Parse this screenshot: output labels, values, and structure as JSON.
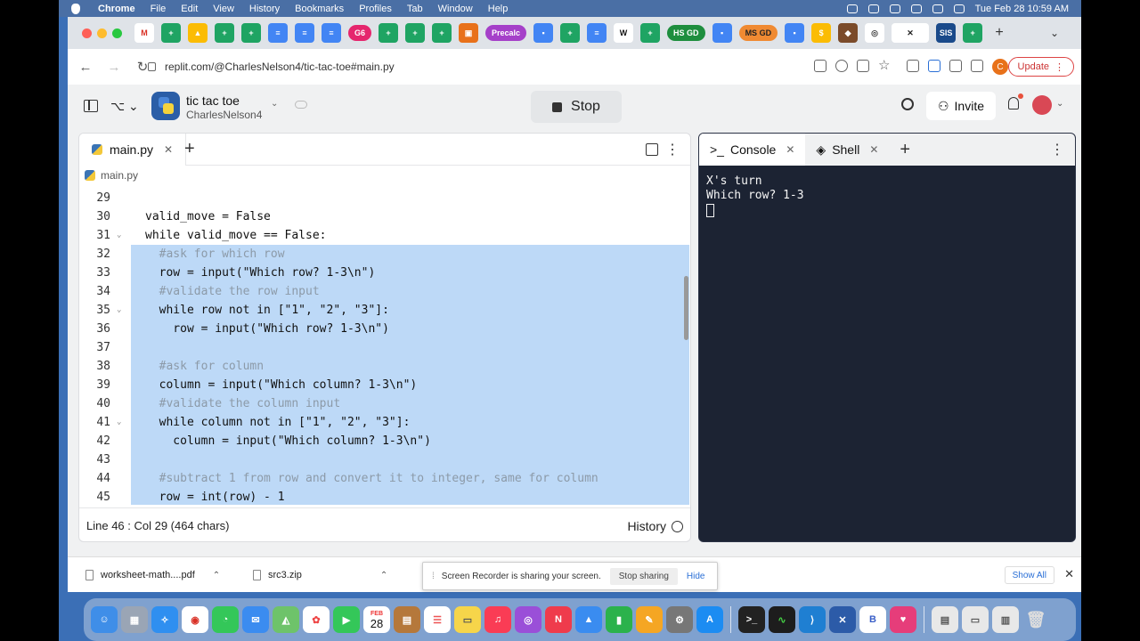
{
  "menubar": {
    "items": [
      "Chrome",
      "File",
      "Edit",
      "View",
      "History",
      "Bookmarks",
      "Profiles",
      "Tab",
      "Window",
      "Help"
    ],
    "clock": "Tue Feb 28  10:59 AM"
  },
  "browser": {
    "tab_labels": {
      "g6": "G6",
      "precalc": "Precalc",
      "hsgd": "HS GD",
      "msgd": "MS GD"
    },
    "url": "replit.com/@CharlesNelson4/tic-tac-toe#main.py",
    "profile_initial": "C",
    "update_label": "Update",
    "colors": {
      "g6": "#e5266d",
      "precalc": "#a540c9",
      "hsgd": "#1e8e3e",
      "msgd": "#f08a32",
      "sheets": "#1fa463",
      "docs": "#4285f4"
    }
  },
  "replit": {
    "repl_name": "tic tac toe",
    "owner": "CharlesNelson4",
    "stop_label": "Stop",
    "invite_label": "Invite"
  },
  "editor": {
    "tab_label": "main.py",
    "breadcrumb": "main.py",
    "status": "Line 46 : Col 29 (464 chars)",
    "history_label": "History",
    "lines": [
      {
        "n": "29",
        "text": "",
        "sel": false
      },
      {
        "n": "30",
        "text": "valid_move = False",
        "sel": false
      },
      {
        "n": "31",
        "text": "while valid_move == False:",
        "sel": false
      },
      {
        "n": "32",
        "text": "  #ask for which row",
        "sel": true,
        "comment": true
      },
      {
        "n": "33",
        "text": "  row = input(\"Which row? 1-3\\n\")",
        "sel": true
      },
      {
        "n": "34",
        "text": "  #validate the row input",
        "sel": true,
        "comment": true
      },
      {
        "n": "35",
        "text": "  while row not in [\"1\", \"2\", \"3\"]:",
        "sel": true
      },
      {
        "n": "36",
        "text": "    row = input(\"Which row? 1-3\\n\")",
        "sel": true
      },
      {
        "n": "37",
        "text": "",
        "sel": true
      },
      {
        "n": "38",
        "text": "  #ask for column",
        "sel": true,
        "comment": true
      },
      {
        "n": "39",
        "text": "  column = input(\"Which column? 1-3\\n\")",
        "sel": true
      },
      {
        "n": "40",
        "text": "  #validate the column input",
        "sel": true,
        "comment": true
      },
      {
        "n": "41",
        "text": "  while column not in [\"1\", \"2\", \"3\"]:",
        "sel": true
      },
      {
        "n": "42",
        "text": "    column = input(\"Which column? 1-3\\n\")",
        "sel": true
      },
      {
        "n": "43",
        "text": "",
        "sel": true
      },
      {
        "n": "44",
        "text": "  #subtract 1 from row and convert it to integer, same for column",
        "sel": true,
        "comment": true
      },
      {
        "n": "45",
        "text": "  row = int(row) - 1",
        "sel": true
      }
    ],
    "fold_lines": [
      "31",
      "35",
      "41"
    ],
    "selection_color": "#bdd9f7"
  },
  "console": {
    "tab_console": "Console",
    "tab_shell": "Shell",
    "output": "X's turn\nWhich row? 1-3"
  },
  "downloads": {
    "file1": "worksheet-math....pdf",
    "file2": "src3.zip",
    "recorder_text": "Screen Recorder is sharing your screen.",
    "stop_sharing": "Stop sharing",
    "hide": "Hide",
    "show_all": "Show All"
  },
  "dock": {
    "calendar_month": "FEB",
    "calendar_day": "28"
  }
}
